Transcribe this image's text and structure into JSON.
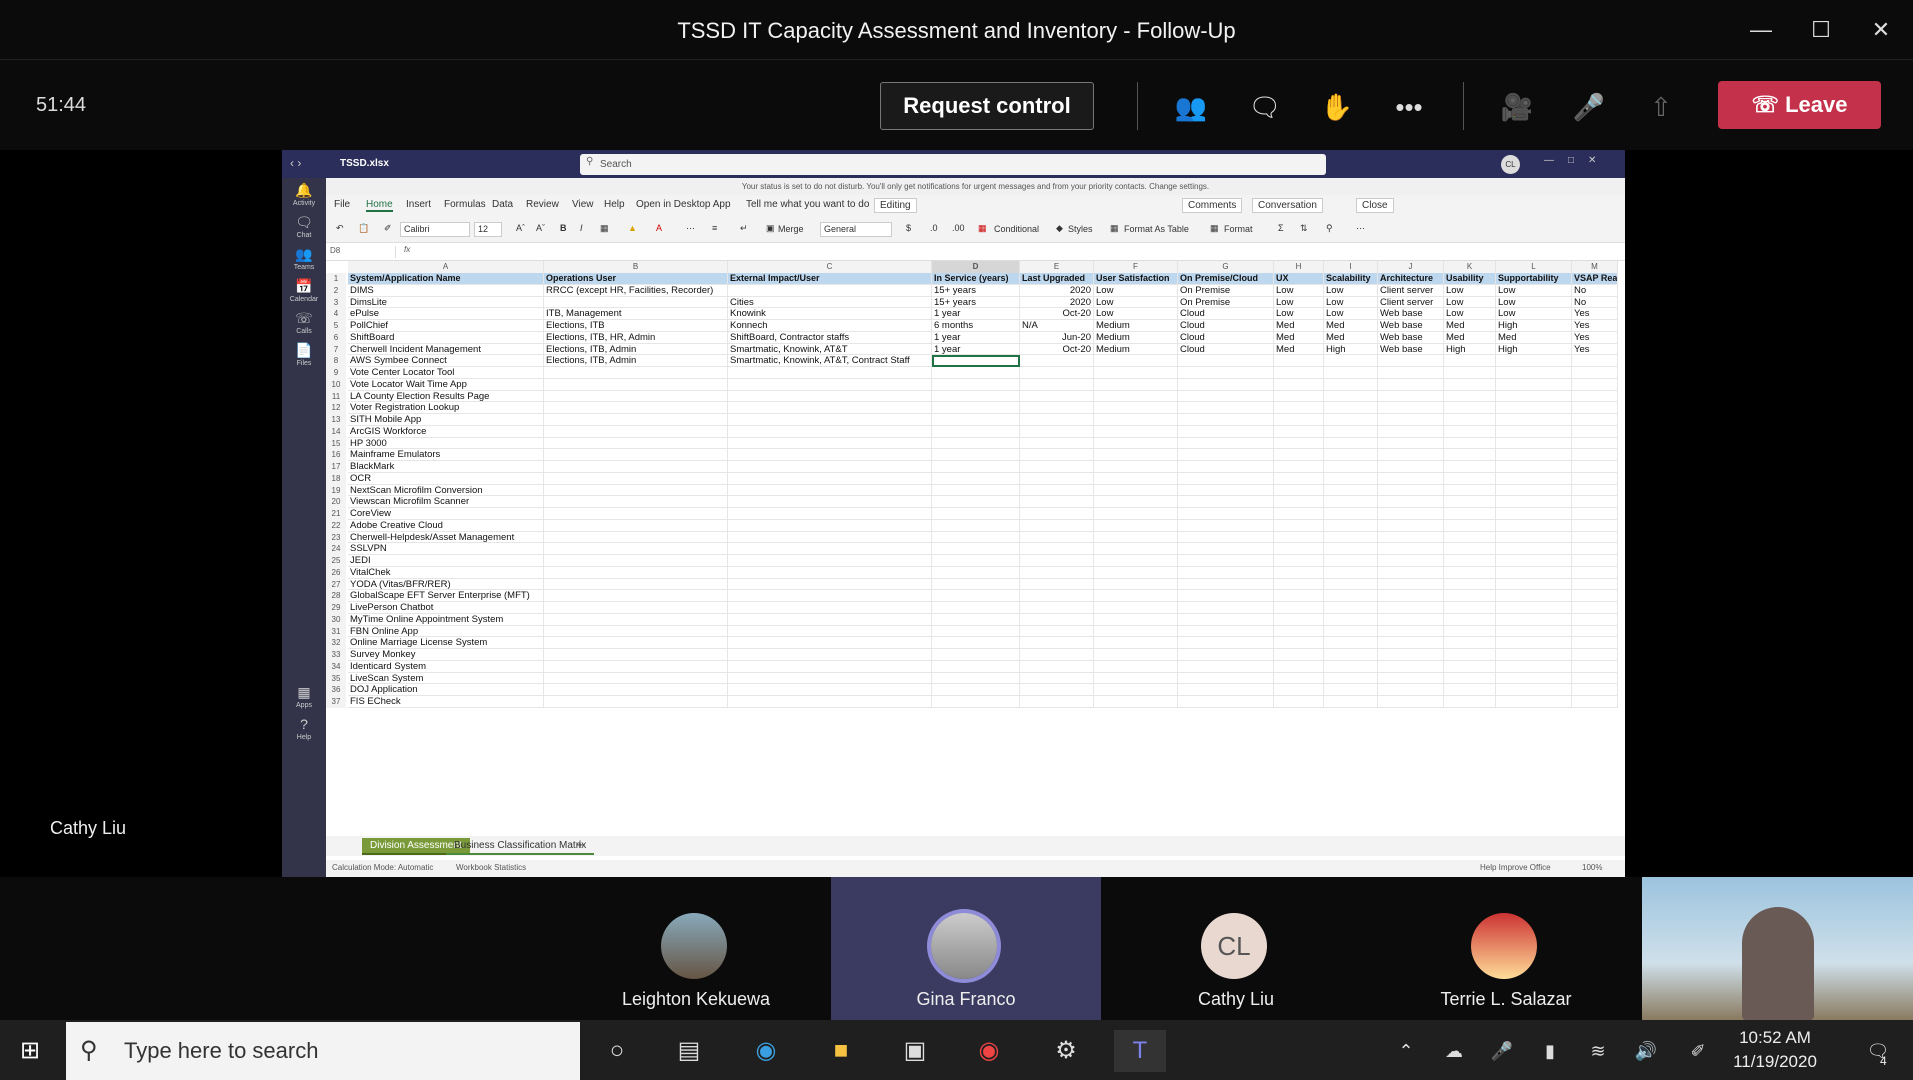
{
  "meeting": {
    "title": "TSSD IT Capacity Assessment and Inventory - Follow-Up",
    "timer": "51:44",
    "request_control": "Request control",
    "leave": "Leave",
    "presenter_label": "Cathy Liu"
  },
  "excel": {
    "filename": "TSSD.xlsx",
    "search_placeholder": "Search",
    "user_initials": "CL",
    "notice": "Your status is set to do not disturb. You'll only get notifications for urgent messages and from your priority contacts. Change settings.",
    "ribbon_tabs": [
      "File",
      "Home",
      "Insert",
      "Formulas",
      "Data",
      "Review",
      "View",
      "Help",
      "Open in Desktop App",
      "Tell me what you want to do"
    ],
    "editing": "Editing",
    "comments": "Comments",
    "conversation": "Conversation",
    "close": "Close",
    "font_name": "Calibri",
    "font_size": "12",
    "number_format": "General",
    "merge": "Merge",
    "conditional": "Conditional",
    "styles": "Styles",
    "format_as_table": "Format As Table",
    "format": "Format",
    "name_box": "D8",
    "fx": "fx",
    "column_letters": [
      "A",
      "B",
      "C",
      "D",
      "E",
      "F",
      "G",
      "H",
      "I",
      "J",
      "K",
      "L",
      "M"
    ],
    "headers": [
      "System/Application Name",
      "Operations User",
      "External Impact/User",
      "In Service (years)",
      "Last Upgraded",
      "User Satisfaction",
      "On Premise/Cloud",
      "UX",
      "Scalability",
      "Architecture",
      "Usability",
      "Supportability",
      "VSAP Rea"
    ],
    "rows": [
      [
        "DIMS",
        "RRCC (except HR, Facilities, Recorder)",
        "",
        "15+ years",
        "2020",
        "Low",
        "On Premise",
        "Low",
        "Low",
        "Client server",
        "Low",
        "Low",
        "No"
      ],
      [
        "DimsLite",
        "",
        "Cities",
        "15+ years",
        "2020",
        "Low",
        "On Premise",
        "Low",
        "Low",
        "Client server",
        "Low",
        "Low",
        "No"
      ],
      [
        "ePulse",
        "ITB, Management",
        "Knowink",
        "1 year",
        "Oct-20",
        "Low",
        "Cloud",
        "Low",
        "Low",
        "Web base",
        "Low",
        "Low",
        "Yes"
      ],
      [
        "PollChief",
        "Elections, ITB",
        "Konnech",
        "6 months",
        "N/A",
        "Medium",
        "Cloud",
        "Med",
        "Med",
        "Web base",
        "Med",
        "High",
        "Yes"
      ],
      [
        "ShiftBoard",
        "Elections, ITB, HR, Admin",
        "ShiftBoard, Contractor staffs",
        "1 year",
        "Jun-20",
        "Medium",
        "Cloud",
        "Med",
        "Med",
        "Web base",
        "Med",
        "Med",
        "Yes"
      ],
      [
        "Cherwell Incident Management",
        "Elections, ITB, Admin",
        "Smartmatic, Knowink, AT&T",
        "1 year",
        "Oct-20",
        "Medium",
        "Cloud",
        "Med",
        "High",
        "Web base",
        "High",
        "High",
        "Yes"
      ],
      [
        "AWS Symbee Connect",
        "Elections, ITB, Admin",
        "Smartmatic, Knowink, AT&T, Contract Staff",
        "",
        "",
        "",
        "",
        "",
        "",
        "",
        "",
        "",
        ""
      ],
      [
        "Vote Center Locator Tool"
      ],
      [
        "Vote Locator Wait Time App"
      ],
      [
        "LA County Election Results Page"
      ],
      [
        "Voter Registration Lookup"
      ],
      [
        "SITH Mobile App"
      ],
      [
        "ArcGIS Workforce"
      ],
      [
        "HP 3000"
      ],
      [
        "Mainframe Emulators"
      ],
      [
        "BlackMark"
      ],
      [
        "OCR"
      ],
      [
        "NextScan Microfilm Conversion"
      ],
      [
        "Viewscan Microfilm Scanner"
      ],
      [
        "CoreView"
      ],
      [
        "Adobe Creative Cloud"
      ],
      [
        "Cherwell-Helpdesk/Asset Management"
      ],
      [
        "SSLVPN"
      ],
      [
        "JEDI"
      ],
      [
        "VitalChek"
      ],
      [
        "YODA (Vitas/BFR/RER)"
      ],
      [
        "GlobalScape EFT Server Enterprise (MFT)"
      ],
      [
        "LivePerson Chatbot"
      ],
      [
        "MyTime Online Appointment System"
      ],
      [
        "FBN Online App"
      ],
      [
        "Online Marriage License System"
      ],
      [
        "Survey Monkey"
      ],
      [
        "Identicard System"
      ],
      [
        "LiveScan System"
      ],
      [
        "DOJ Application"
      ],
      [
        "FIS ECheck"
      ]
    ],
    "sheet_tabs": [
      "Division Assessment",
      "Business Classification Matrix"
    ],
    "status_left": "Calculation Mode: Automatic",
    "status_mid": "Workbook Statistics",
    "status_help": "Help Improve Office",
    "zoom": "100%",
    "rail": [
      "Activity",
      "Chat",
      "Teams",
      "Calendar",
      "Calls",
      "Files",
      "Apps",
      "Help"
    ]
  },
  "participants": [
    {
      "name": "Leighton Kekuewa"
    },
    {
      "name": "Gina Franco"
    },
    {
      "name": "Cathy Liu",
      "initials": "CL"
    },
    {
      "name": "Terrie L. Salazar"
    }
  ],
  "taskbar": {
    "search_placeholder": "Type here to search",
    "time": "10:52 AM",
    "date": "11/19/2020",
    "notifications": "4"
  }
}
